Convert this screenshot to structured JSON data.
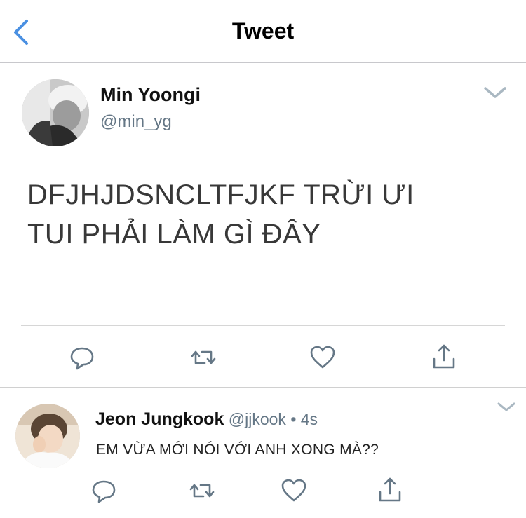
{
  "header": {
    "title": "Tweet",
    "back_icon": "chevron-left-icon",
    "accent_color": "#4a90e2"
  },
  "tweet": {
    "author_name": "Min Yoongi",
    "author_handle": "@min_yg",
    "text_line1": "DFJHJDSNCLTFJKF TRỪI ƯI",
    "text_line2": "TUI PHẢI LÀM GÌ ĐÂY",
    "actions": [
      "reply-icon",
      "retweet-icon",
      "like-icon",
      "share-icon"
    ]
  },
  "reply": {
    "author_name": "Jeon Jungkook",
    "author_handle": "@jjkook",
    "separator": "•",
    "time": "4s",
    "text": "EM VỪA MỚI NÓI VỚI ANH XONG MÀ??",
    "actions": [
      "reply-icon",
      "retweet-icon",
      "like-icon",
      "share-icon"
    ]
  },
  "colors": {
    "icon_gray": "#657786",
    "divider": "#d6d6d6"
  }
}
